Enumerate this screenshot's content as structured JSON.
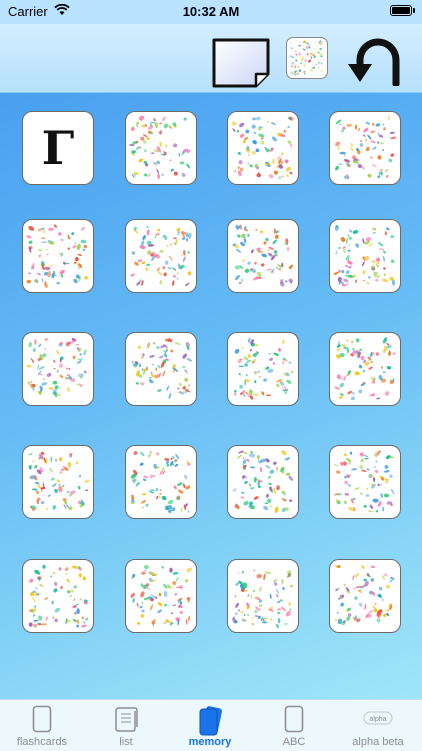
{
  "status_bar": {
    "carrier": "Carrier",
    "time": "10:32 AM"
  },
  "toolbar": {
    "buttons": [
      {
        "name": "blank-card-icon",
        "role": "new card / blank"
      },
      {
        "name": "card-back-thumbnail",
        "role": "card back pattern"
      },
      {
        "name": "undo-arrow-icon",
        "role": "flip / undo"
      }
    ]
  },
  "board": {
    "rows": 5,
    "columns": 4,
    "revealed_card": {
      "row": 1,
      "column": 1,
      "text": "Γ"
    },
    "face_down_count": 19
  },
  "tab_bar": {
    "tabs": [
      {
        "label": "flashcards",
        "icon": "card-outline-icon",
        "active": false
      },
      {
        "label": "list",
        "icon": "scroll-icon",
        "active": false
      },
      {
        "label": "memory",
        "icon": "cards-stack-icon",
        "active": true
      },
      {
        "label": "ABC",
        "icon": "card-outline-icon",
        "active": false
      },
      {
        "label": "alpha beta",
        "icon": "alpha-badge-icon",
        "badge": "alpha",
        "active": false
      }
    ]
  },
  "colors": {
    "active_tab": "#1a73e8",
    "inactive_tab": "#8e8e93",
    "board_top": "#4aa0f0",
    "board_bottom": "#9fe6f8"
  }
}
